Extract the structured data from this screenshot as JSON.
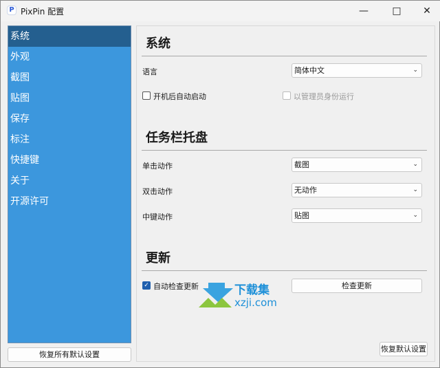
{
  "window": {
    "title": "PixPin 配置",
    "minimize_icon": "minimize-icon",
    "maximize_icon": "maximize-icon",
    "close_icon": "close-icon"
  },
  "sidebar": {
    "items": [
      {
        "label": "系统",
        "active": true
      },
      {
        "label": "外观"
      },
      {
        "label": "截图"
      },
      {
        "label": "贴图"
      },
      {
        "label": "保存"
      },
      {
        "label": "标注"
      },
      {
        "label": "快捷键"
      },
      {
        "label": "关于"
      },
      {
        "label": "开源许可"
      }
    ],
    "restore_all_label": "恢复所有默认设置",
    "active_color": "#245f8f",
    "bg_color": "#3c97dd"
  },
  "system": {
    "title": "系统",
    "language_label": "语言",
    "language_value": "简体中文",
    "autostart_label": "开机后自动启动",
    "autostart_checked": false,
    "admin_label": "以管理员身份运行",
    "admin_checked": false,
    "admin_disabled": true
  },
  "tray": {
    "title": "任务栏托盘",
    "single_click_label": "单击动作",
    "single_click_value": "截图",
    "double_click_label": "双击动作",
    "double_click_value": "无动作",
    "middle_click_label": "中键动作",
    "middle_click_value": "贴图"
  },
  "update": {
    "title": "更新",
    "auto_check_label": "自动检查更新",
    "auto_check_checked": true,
    "check_button": "检查更新"
  },
  "restore_default_label": "恢复默认设置",
  "watermark": {
    "text": "下载集",
    "domain": "xzji.com"
  }
}
